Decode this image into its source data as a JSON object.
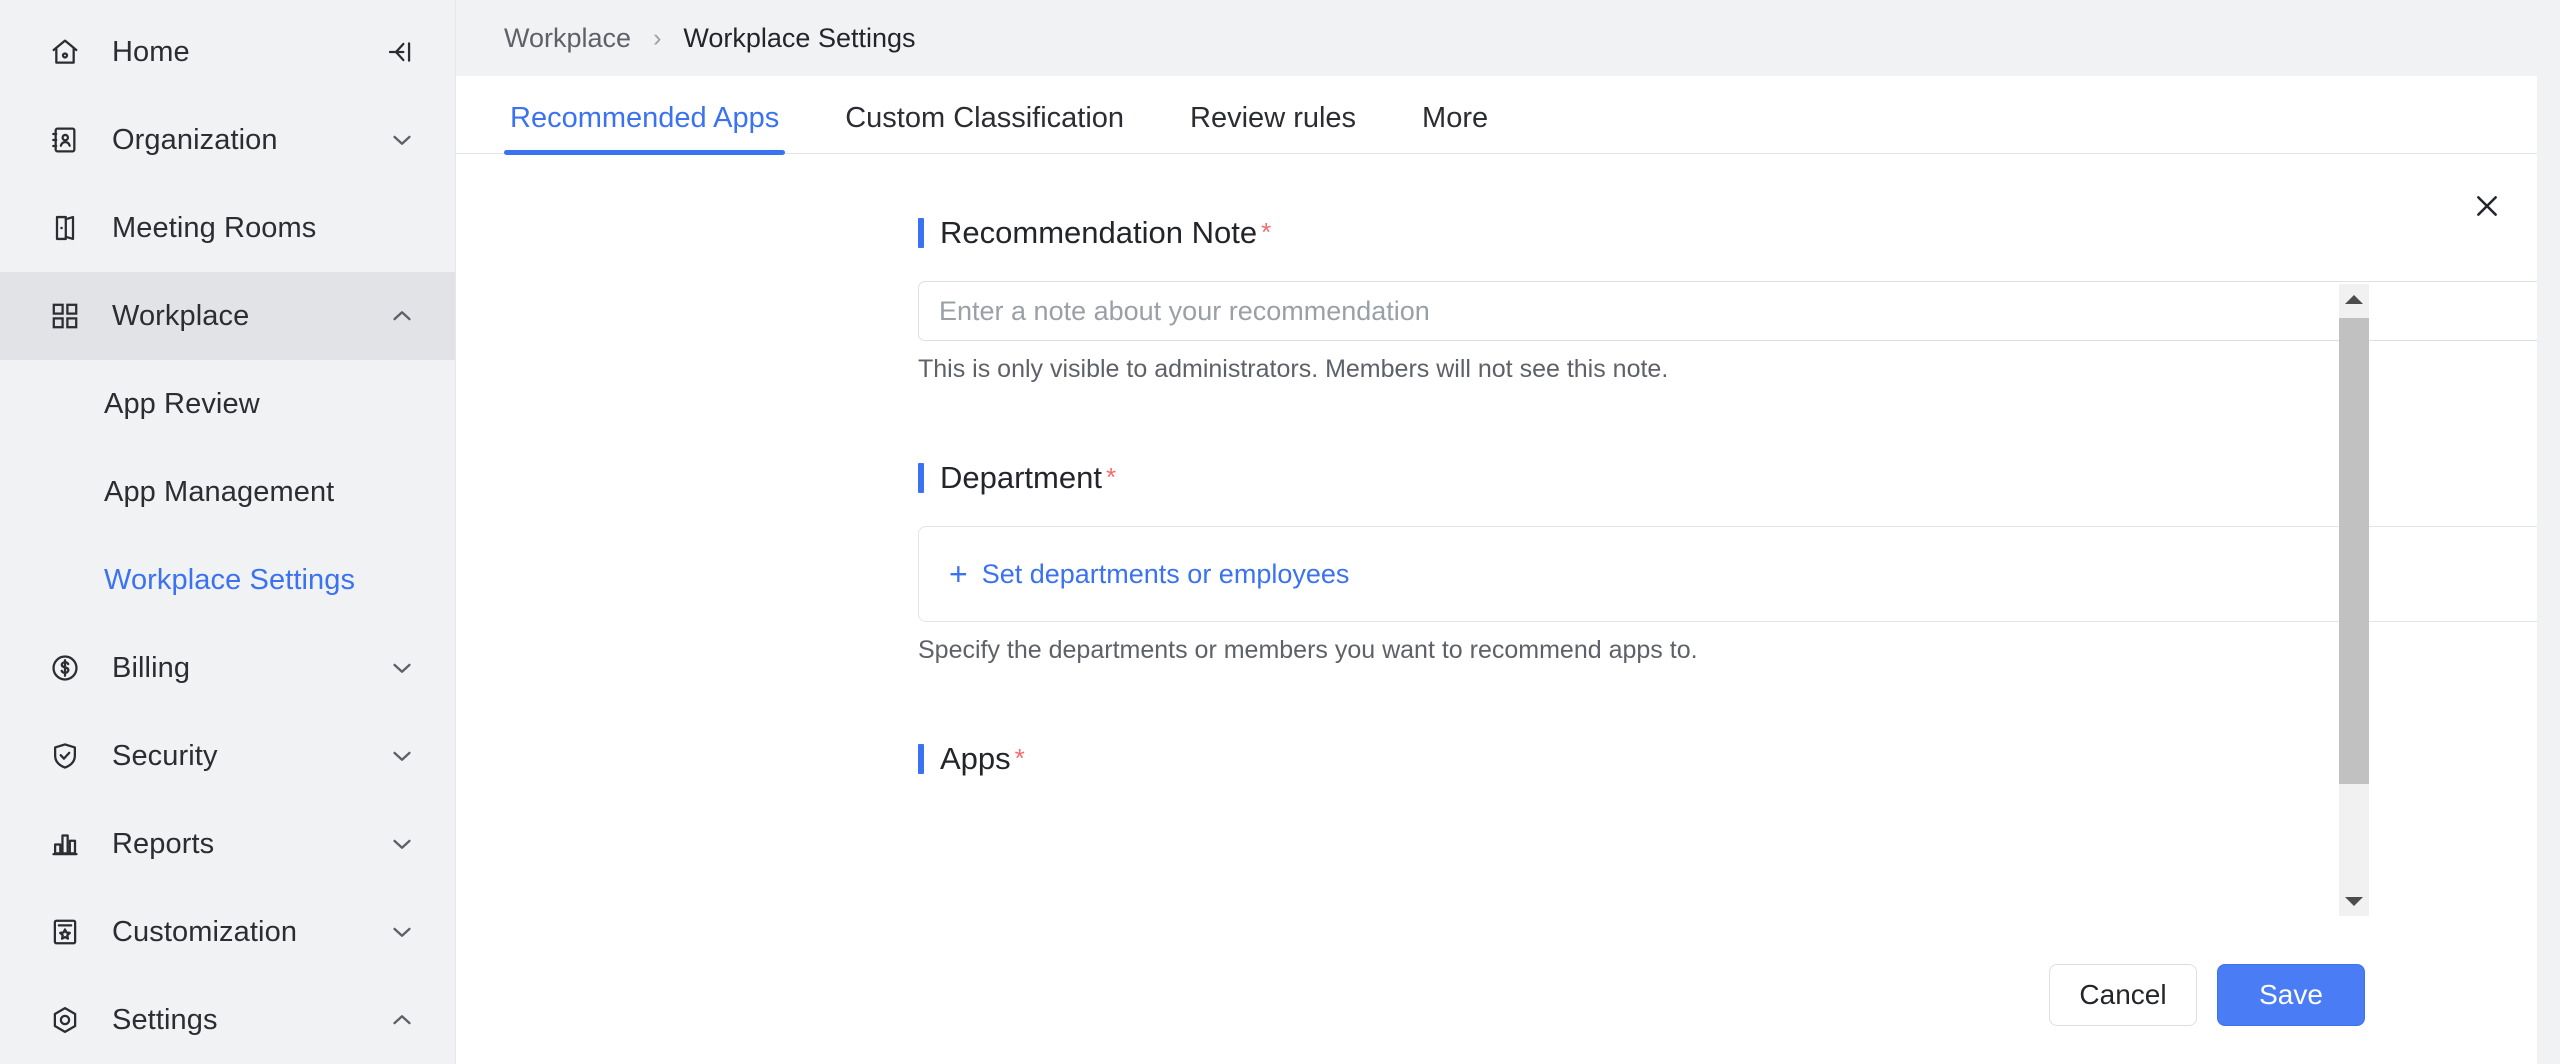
{
  "sidebar": {
    "collapse_icon": "collapse-panel-icon",
    "items": [
      {
        "label": "Home",
        "icon": "home-icon",
        "chevron": null,
        "active": false,
        "type": "top"
      },
      {
        "label": "Organization",
        "icon": "organization-icon",
        "chevron": "down",
        "active": false,
        "type": "top"
      },
      {
        "label": "Meeting Rooms",
        "icon": "meeting-rooms-icon",
        "chevron": null,
        "active": false,
        "type": "top"
      },
      {
        "label": "Workplace",
        "icon": "workplace-grid-icon",
        "chevron": "up",
        "active": true,
        "type": "top"
      },
      {
        "label": "App Review",
        "icon": null,
        "chevron": null,
        "active": false,
        "type": "sub"
      },
      {
        "label": "App Management",
        "icon": null,
        "chevron": null,
        "active": false,
        "type": "sub"
      },
      {
        "label": "Workplace Settings",
        "icon": null,
        "chevron": null,
        "active": false,
        "selected": true,
        "type": "sub"
      },
      {
        "label": "Billing",
        "icon": "billing-dollar-icon",
        "chevron": "down",
        "active": false,
        "type": "top"
      },
      {
        "label": "Security",
        "icon": "security-shield-icon",
        "chevron": "down",
        "active": false,
        "type": "top"
      },
      {
        "label": "Reports",
        "icon": "reports-bar-chart-icon",
        "chevron": "down",
        "active": false,
        "type": "top"
      },
      {
        "label": "Customization",
        "icon": "customization-badge-icon",
        "chevron": "down",
        "active": false,
        "type": "top"
      },
      {
        "label": "Settings",
        "icon": "settings-gear-icon",
        "chevron": "up",
        "active": false,
        "type": "top"
      }
    ]
  },
  "breadcrumb": {
    "parent": "Workplace",
    "separator": "›",
    "current": "Workplace Settings"
  },
  "tabs": [
    {
      "label": "Recommended Apps",
      "active": true
    },
    {
      "label": "Custom Classification",
      "active": false
    },
    {
      "label": "Review rules",
      "active": false
    },
    {
      "label": "More",
      "active": false
    }
  ],
  "close_icon": "close-icon",
  "form": {
    "fields": [
      {
        "label": "Recommendation Note",
        "required_mark": "*",
        "control": "text-input",
        "value": "",
        "placeholder": "Enter a note about your recommendation",
        "helper": "This is only visible to administrators. Members will not see this note."
      },
      {
        "label": "Department",
        "required_mark": "*",
        "control": "picker",
        "add_label": "Set departments or employees",
        "plus": "+",
        "helper": "Specify the departments or members you want to recommend apps to."
      },
      {
        "label": "Apps",
        "required_mark": "*",
        "control": "none",
        "helper": ""
      }
    ]
  },
  "footer": {
    "cancel_label": "Cancel",
    "save_label": "Save"
  },
  "colors": {
    "accent": "#3b72f2",
    "save_bg": "#4a7cf5",
    "required": "#f56c6c",
    "sidebar_bg": "#f1f2f4",
    "active_row": "#e2e3e6"
  }
}
